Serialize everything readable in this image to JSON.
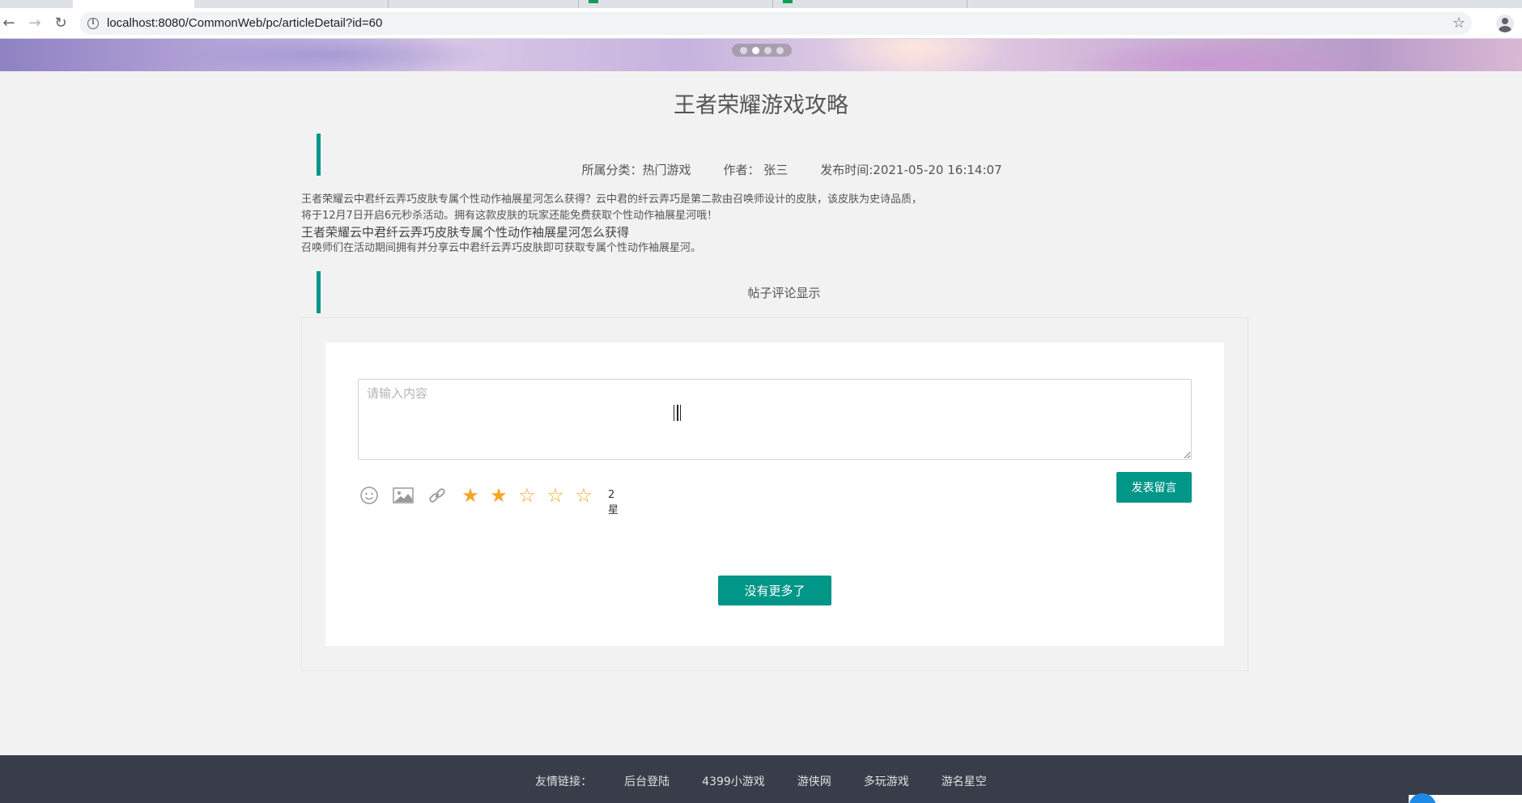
{
  "browser": {
    "url": "localhost:8080/CommonWeb/pc/articleDetail?id=60"
  },
  "article": {
    "title": "王者荣耀游戏攻略",
    "category_label": "所属分类：热门游戏",
    "author_label": "作者： 张三",
    "publish_label": "发布时间:2021-05-20 16:14:07",
    "body_line1": "王者荣耀云中君纤云弄巧皮肤专属个性动作袖展星河怎么获得？云中君的纤云弄巧是第二款由召唤师设计的皮肤，该皮肤为史诗品质，",
    "body_line2": "将于12月7日开启6元秒杀活动。拥有这款皮肤的玩家还能免费获取个性动作袖展星河哦！",
    "body_subtitle": "王者荣耀云中君纤云弄巧皮肤专属个性动作袖展星河怎么获得",
    "body_line3": "召唤师们在活动期间拥有并分享云中君纤云弄巧皮肤即可获取专属个性动作袖展星河。"
  },
  "comments": {
    "section_title": "帖子评论显示",
    "textarea_placeholder": "请输入内容",
    "rating_text": "2星",
    "rating_value": 2,
    "rating_max": 5,
    "post_button": "发表留言",
    "more_button": "没有更多了"
  },
  "footer": {
    "label": "友情链接：",
    "links": [
      "后台登陆",
      "4399小游戏",
      "游侠网",
      "多玩游戏",
      "游名星空"
    ]
  },
  "colors": {
    "accent": "#009688",
    "star": "#f5a623",
    "footer_bg": "#393d49"
  }
}
